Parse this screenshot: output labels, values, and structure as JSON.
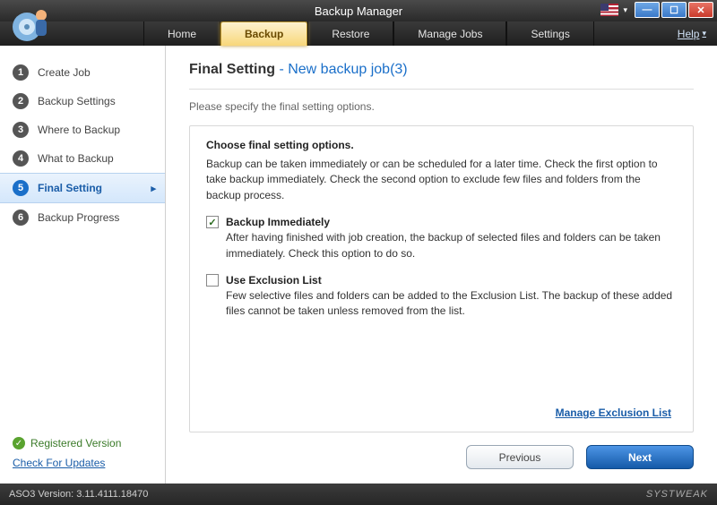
{
  "window": {
    "title": "Backup Manager"
  },
  "menu": {
    "home": "Home",
    "backup": "Backup",
    "restore": "Restore",
    "manage": "Manage Jobs",
    "settings": "Settings",
    "help": "Help"
  },
  "sidebar": {
    "steps": [
      {
        "num": "1",
        "label": "Create Job"
      },
      {
        "num": "2",
        "label": "Backup Settings"
      },
      {
        "num": "3",
        "label": "Where to Backup"
      },
      {
        "num": "4",
        "label": "What to Backup"
      },
      {
        "num": "5",
        "label": "Final Setting"
      },
      {
        "num": "6",
        "label": "Backup Progress"
      }
    ],
    "registered": "Registered Version",
    "updates": "Check For Updates"
  },
  "page": {
    "title_main": "Final Setting",
    "title_sep": " - ",
    "title_sub": "New backup job(3)",
    "subtitle": "Please specify the final setting options.",
    "panel_heading": "Choose final setting options.",
    "panel_intro": "Backup can be taken immediately or can be scheduled for a later time. Check the first option to take backup immediately. Check the second option to exclude few files and folders from the backup process.",
    "opt1_label": "Backup Immediately",
    "opt1_desc": "After having finished with job creation, the backup of selected files and folders can be taken immediately. Check this option to do so.",
    "opt1_checked": true,
    "opt2_label": "Use Exclusion List",
    "opt2_desc": "Few selective files and folders can be added to the Exclusion List. The backup of these added files cannot be taken unless removed from the list.",
    "opt2_checked": false,
    "manage_link": "Manage Exclusion List",
    "btn_prev": "Previous",
    "btn_next": "Next"
  },
  "status": {
    "version_label": "ASO3 Version: 3.11.4111.18470",
    "brand": "SYSTWEAK"
  }
}
